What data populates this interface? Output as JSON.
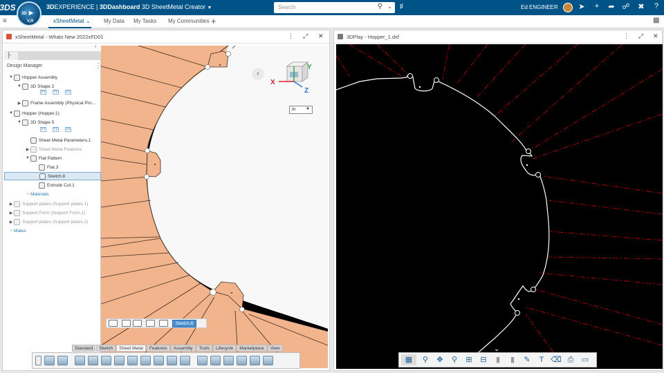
{
  "topbar": {
    "logo": "3DS",
    "brand_prefix": "3D",
    "brand_experience": "EXPERIENCE",
    "brand_sep": " | ",
    "brand_dash": "3DDashboard",
    "brand_app": "3D SheetMetal Creator",
    "search_placeholder": "Search",
    "user_name": "Ed ENGINEER",
    "compass_3d": "3D",
    "compass_vr": "V,R",
    "compass_play": "▶"
  },
  "tabs": [
    {
      "label": "xSheetMetal",
      "active": true
    },
    {
      "label": "My Data",
      "active": false
    },
    {
      "label": "My Tasks",
      "active": false
    },
    {
      "label": "My Communities",
      "active": false
    }
  ],
  "left_pane": {
    "title": "xSheetMetal - Whats New 2022xFD01",
    "design_manager_title": "Design Manager",
    "unit": "in",
    "tree": [
      {
        "label": "Hopper Assembly",
        "level": 0,
        "arrow": "▼",
        "state": "normal"
      },
      {
        "label": "3D Shape 2",
        "level": 1,
        "arrow": "▼",
        "state": "normal"
      },
      {
        "label": "Frame Assembly (Physical Pro...",
        "level": 1,
        "arrow": "▶",
        "state": "normal"
      },
      {
        "label": "Hopper (Hopper.1)",
        "level": 0,
        "arrow": "▼",
        "state": "normal"
      },
      {
        "label": "3D Shape 5",
        "level": 1,
        "arrow": "▼",
        "state": "normal"
      },
      {
        "label": "Sheet Metal Parameters.1",
        "level": 2,
        "arrow": "",
        "state": "normal"
      },
      {
        "label": "Sheet Metal Features",
        "level": 2,
        "arrow": "▶",
        "state": "dim"
      },
      {
        "label": "Flat Pattern",
        "level": 2,
        "arrow": "▼",
        "state": "normal"
      },
      {
        "label": "Flat.3",
        "level": 3,
        "arrow": "",
        "state": "normal"
      },
      {
        "label": "Sketch.8",
        "level": 3,
        "arrow": "",
        "state": "sel"
      },
      {
        "label": "Extrude Cut.1",
        "level": 3,
        "arrow": "",
        "state": "normal"
      },
      {
        "label": "Materials",
        "level": 2,
        "arrow": "›",
        "state": "link"
      },
      {
        "label": "Support plates (Support plates.1)",
        "level": 0,
        "arrow": "▶",
        "state": "dim"
      },
      {
        "label": "Support Form (Support Form.1)",
        "level": 0,
        "arrow": "▶",
        "state": "dim"
      },
      {
        "label": "Support plates (Support plates.2)",
        "level": 0,
        "arrow": "▶",
        "state": "dim"
      },
      {
        "label": "Mates",
        "level": 0,
        "arrow": "›",
        "state": "link"
      }
    ],
    "mini_labels": [
      "XY",
      "YZ",
      "ZX"
    ],
    "triad_x": "X",
    "triad_y": "Y",
    "triad_z": "Z",
    "minibar_sketch": "Sketch.8",
    "bottom_tabs": [
      {
        "label": "Standard",
        "active": false
      },
      {
        "label": "Sketch",
        "active": false
      },
      {
        "label": "Sheet Metal",
        "active": true
      },
      {
        "label": "Features",
        "active": false
      },
      {
        "label": "Assembly",
        "active": false
      },
      {
        "label": "Tools",
        "active": false
      },
      {
        "label": "Lifecycle",
        "active": false
      },
      {
        "label": "Marketplace",
        "active": false
      },
      {
        "label": "View",
        "active": false
      }
    ]
  },
  "right_pane": {
    "title": "3DPlay - Hopper_1.dxf"
  },
  "colors": {
    "brand_blue": "#005386",
    "sheet_orange": "#f2b48c",
    "cut_red": "#cc0000"
  }
}
